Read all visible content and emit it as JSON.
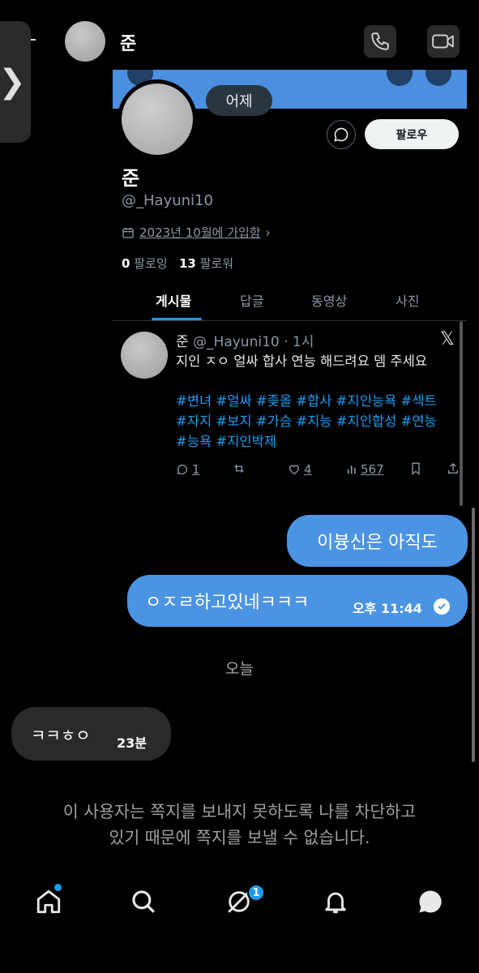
{
  "header": {
    "contact_name": "준",
    "icons": {
      "call": "phone-icon",
      "video": "video-icon",
      "side_tab": "chevron-right-icon"
    }
  },
  "shared_profile": {
    "day_separator": "어제",
    "follow_label": "팔로우",
    "name": "준",
    "handle": "@_Hayuni10",
    "joined": "2023년 10월에 가입함",
    "following_count": "0",
    "following_label": "팔로잉",
    "followers_count": "13",
    "followers_label": "팔로워",
    "tabs": [
      {
        "label": "게시물",
        "active": true
      },
      {
        "label": "답글",
        "active": false
      },
      {
        "label": "동영상",
        "active": false
      },
      {
        "label": "사진",
        "active": false
      }
    ],
    "tweet": {
      "name": "준",
      "handle": "@_Hayuni10",
      "time": "· 1시",
      "text": "지인 ㅈㅇ 얼싸 합사 연능 해드려요 뎀 주세요",
      "hashtags_line1": "#변녀 #얼싸 #좆올 #합사 #지인능욕 #섹트",
      "hashtags_line2": "#자지 #보지 #가슴 #지능 #지인합성 #연능",
      "hashtags_line3": "#능욕 #지인박제",
      "replies": "1",
      "likes": "4",
      "views": "567"
    }
  },
  "messages": {
    "sent_1": "이븅신은 아직도",
    "sent_2": "ㅇㅈㄹ하고있네ㅋㅋㅋ",
    "sent_2_time": "오후 11:44",
    "today_separator": "오늘",
    "received_1": "ㅋㅋㅎㅇ",
    "received_1_time": "23분"
  },
  "blocked_notice": {
    "line1": "이 사용자는 쪽지를 보내지 못하도록 나를 차단하고",
    "line2": "있기 때문에 쪽지를 보낼 수 없습니다."
  },
  "bottom_nav": {
    "items": [
      "home-icon",
      "search-icon",
      "grok-icon",
      "notifications-icon",
      "messages-icon"
    ],
    "grok_badge": "1"
  },
  "colors": {
    "accent": "#1d9bf0",
    "sent_bubble": "#4b94e3",
    "received_bubble": "#2a2a2a",
    "banner": "#4b8fe0"
  }
}
